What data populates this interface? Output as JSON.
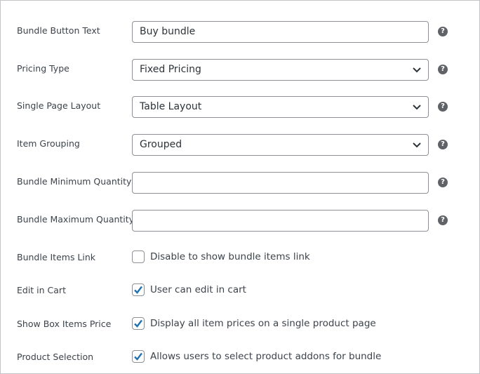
{
  "fields": [
    {
      "label": "Bundle Button Text",
      "value": "Buy bundle",
      "type": "text"
    },
    {
      "label": "Pricing Type",
      "value": "Fixed Pricing",
      "type": "select"
    },
    {
      "label": "Single Page Layout",
      "value": "Table Layout",
      "type": "select"
    },
    {
      "label": "Item Grouping",
      "value": "Grouped",
      "type": "select"
    },
    {
      "label": "Bundle Minimum Quantity",
      "value": "",
      "type": "text"
    },
    {
      "label": "Bundle Maximum Quantity",
      "value": "",
      "type": "text"
    }
  ],
  "help_icon_glyph": "?",
  "checkboxes": [
    {
      "label": "Bundle Items Link",
      "text": "Disable to show bundle items link",
      "checked": false
    },
    {
      "label": "Edit in Cart",
      "text": "User can edit in cart",
      "checked": true
    },
    {
      "label": "Show Box Items Price",
      "text": "Display all item prices on a single product page",
      "checked": true
    },
    {
      "label": "Product Selection",
      "text": "Allows users to select product addons for bundle",
      "checked": true
    }
  ],
  "colors": {
    "accent": "#2271b1",
    "border": "#8c8f94",
    "help": "#5f6368"
  }
}
